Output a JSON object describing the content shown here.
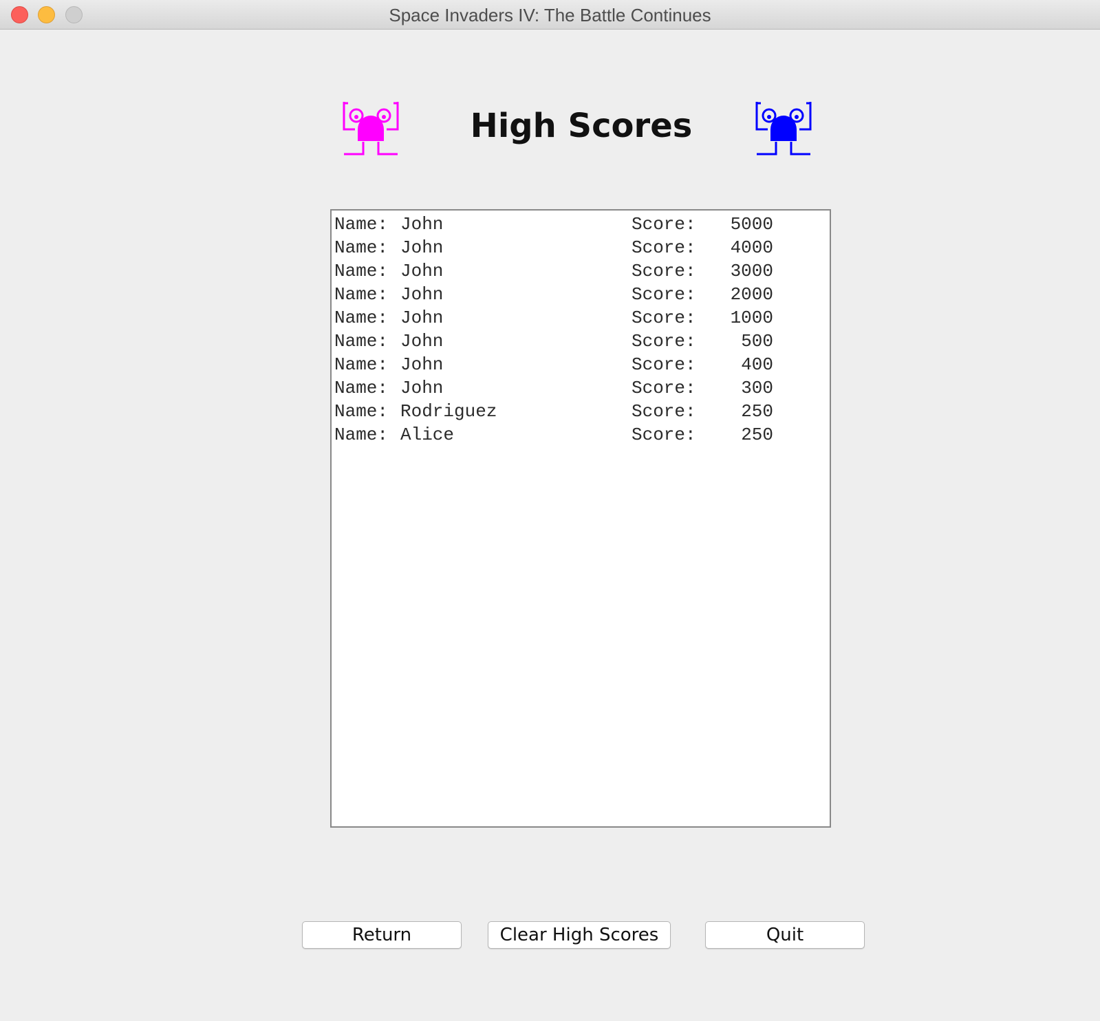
{
  "window": {
    "title": "Space Invaders IV: The Battle Continues"
  },
  "header": {
    "title": "High Scores",
    "left_invader_color": "#ff00ff",
    "right_invader_color": "#0000ff"
  },
  "scores": {
    "name_label": "Name:",
    "score_label": "Score:",
    "rows": [
      {
        "name": "John",
        "score": "5000"
      },
      {
        "name": "John",
        "score": "4000"
      },
      {
        "name": "John",
        "score": "3000"
      },
      {
        "name": "John",
        "score": "2000"
      },
      {
        "name": "John",
        "score": "1000"
      },
      {
        "name": "John",
        "score": "500"
      },
      {
        "name": "John",
        "score": "400"
      },
      {
        "name": "John",
        "score": "300"
      },
      {
        "name": "Rodriguez",
        "score": "250"
      },
      {
        "name": "Alice",
        "score": "250"
      }
    ]
  },
  "buttons": {
    "return_label": "Return",
    "clear_label": "Clear High Scores",
    "quit_label": "Quit"
  }
}
